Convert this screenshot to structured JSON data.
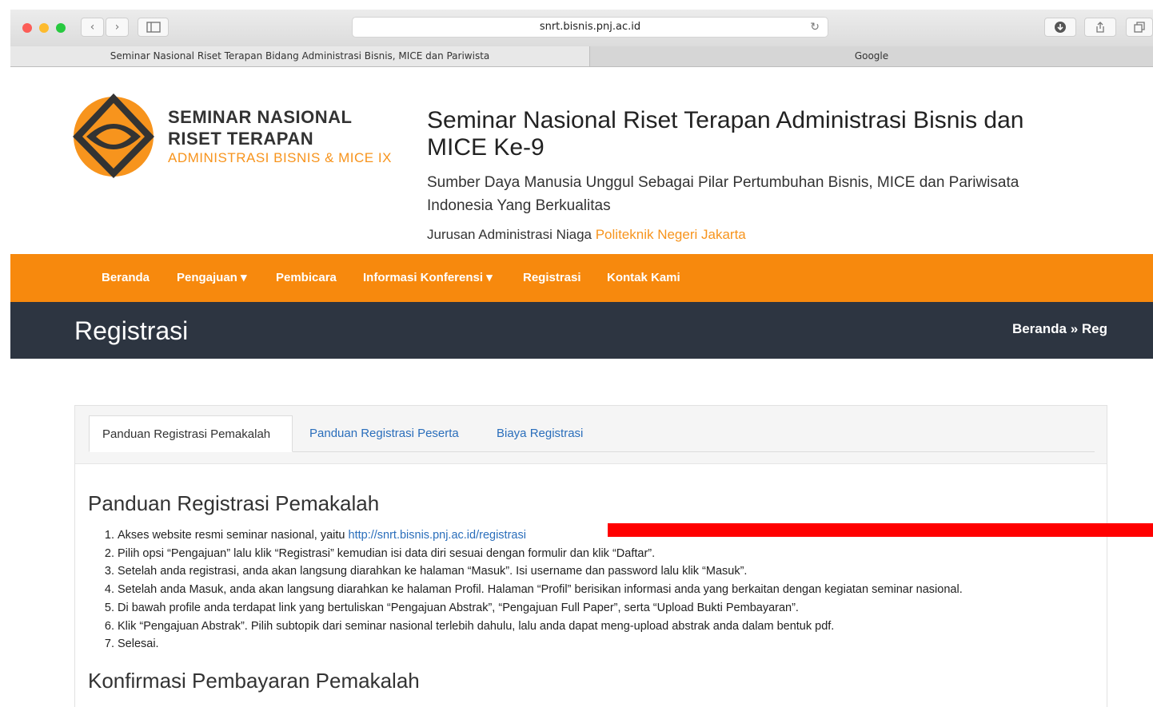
{
  "browser": {
    "url": "snrt.bisnis.pnj.ac.id",
    "tabs": [
      {
        "label": "Seminar Nasional Riset Terapan Bidang Administrasi Bisnis, MICE dan Pariwista"
      },
      {
        "label": "Google"
      }
    ]
  },
  "logo": {
    "line1": "SEMINAR NASIONAL",
    "line2": "RISET TERAPAN",
    "line3": "ADMINISTRASI BISNIS & MICE IX"
  },
  "header": {
    "title": "Seminar Nasional Riset Terapan Administrasi Bisnis dan MICE Ke-9",
    "subtitle": "Sumber Daya Manusia Unggul Sebagai Pilar Pertumbuhan Bisnis, MICE dan Pariwisata Indonesia Yang Berkualitas",
    "dept_prefix": "Jurusan Administrasi Niaga",
    "dept_org": "Politeknik Negeri Jakarta"
  },
  "nav": {
    "items": [
      {
        "label": "Beranda"
      },
      {
        "label": "Pengajuan ▾"
      },
      {
        "label": "Pembicara"
      },
      {
        "label": "Informasi Konferensi ▾"
      },
      {
        "label": "Registrasi"
      },
      {
        "label": "Kontak Kami"
      }
    ]
  },
  "page": {
    "title": "Registrasi",
    "breadcrumb": "Beranda » Reg"
  },
  "content_tabs": [
    {
      "label": "Panduan Registrasi Pemakalah",
      "active": true
    },
    {
      "label": "Panduan Registrasi Peserta",
      "active": false
    },
    {
      "label": "Biaya Registrasi",
      "active": false
    }
  ],
  "section1": {
    "title": "Panduan Registrasi Pemakalah",
    "step1_text": "Akses website resmi seminar nasional, yaitu ",
    "step1_link": "http://snrt.bisnis.pnj.ac.id/registrasi",
    "steps": [
      "Pilih opsi “Pengajuan” lalu klik “Registrasi” kemudian isi data diri sesuai dengan formulir dan klik “Daftar”.",
      "Setelah anda registrasi, anda akan langsung diarahkan ke halaman “Masuk”. Isi username dan password lalu klik “Masuk”.",
      "Setelah anda Masuk, anda akan langsung diarahkan ke halaman Profil. Halaman “Profil” berisikan informasi anda yang berkaitan dengan kegiatan seminar nasional.",
      "Di bawah profile anda terdapat link yang bertuliskan “Pengajuan Abstrak”, “Pengajuan Full Paper”, serta “Upload Bukti Pembayaran”.",
      "Klik “Pengajuan Abstrak”. Pilih subtopik dari seminar nasional terlebih dahulu, lalu anda dapat meng-upload abstrak anda dalam bentuk pdf.",
      "Selesai."
    ]
  },
  "section2": {
    "title": "Konfirmasi Pembayaran Pemakalah"
  }
}
